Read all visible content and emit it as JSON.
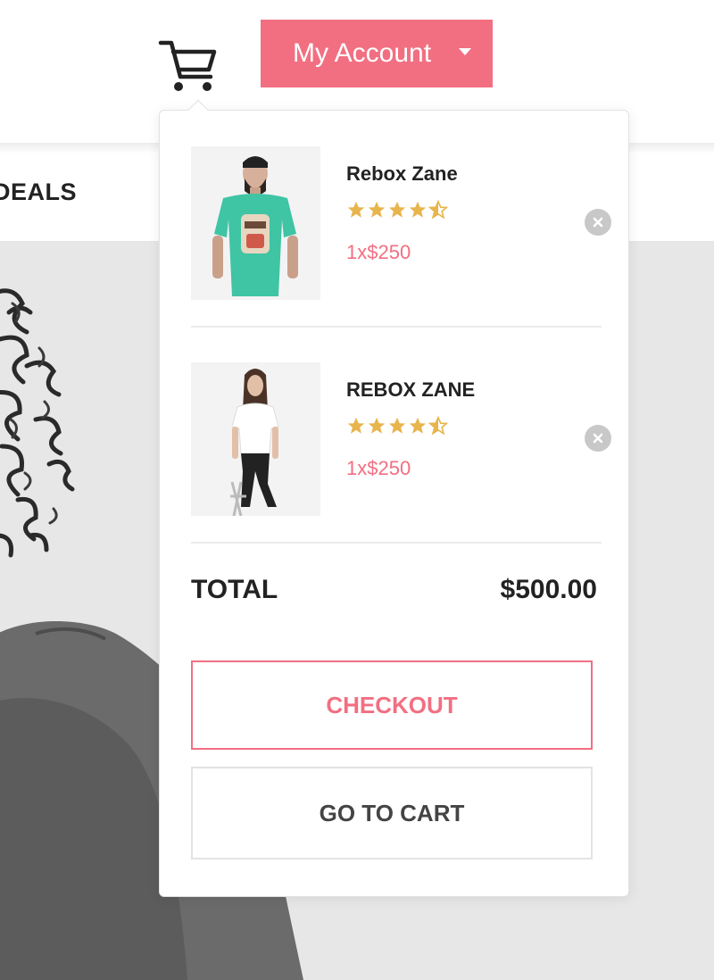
{
  "header": {
    "account_label": "My Account",
    "cart_icon": "shopping-cart-icon",
    "caret_icon": "caret-down-icon"
  },
  "nav": {
    "deals_label": "DEALS"
  },
  "cart": {
    "items": [
      {
        "name": "Rebox Zane",
        "rating": 4.5,
        "price": "1x$250",
        "image": "man-green-tshirt-photo"
      },
      {
        "name": "REBOX ZANE",
        "rating": 4.5,
        "price": "1x$250",
        "image": "woman-white-tshirt-photo"
      }
    ],
    "total_label": "TOTAL",
    "total_value": "$500.00",
    "checkout_label": "CHECKOUT",
    "go_to_cart_label": "GO TO CART"
  },
  "colors": {
    "accent": "#f26f82",
    "star": "#e8b44c",
    "remove": "#c8c8c8"
  }
}
